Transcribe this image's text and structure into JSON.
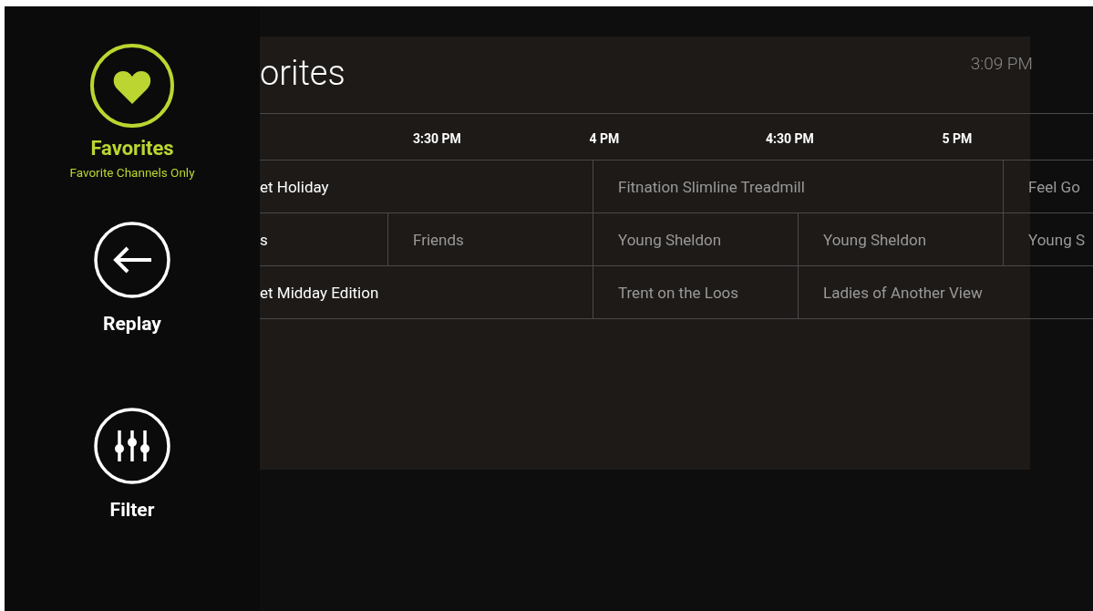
{
  "sidebar": {
    "items": [
      {
        "kind": "heart",
        "label": "Favorites",
        "subtitle": "Favorite Channels Only",
        "selected": true
      },
      {
        "kind": "back",
        "label": "Replay",
        "selected": false
      },
      {
        "kind": "filter",
        "label": "Filter",
        "selected": false
      }
    ]
  },
  "guide": {
    "title": "orites",
    "clock": "3:09 PM",
    "times": [
      "3:30 PM",
      "4 PM",
      "4:30 PM",
      "5 PM"
    ],
    "rows": [
      {
        "programs": [
          {
            "title": "et Holiday",
            "kind": "leadhalf",
            "airing": true
          },
          {
            "title": "Fitnation Slimline Treadmill",
            "kind": "hour",
            "airing": false
          },
          {
            "title": "Feel Go",
            "kind": "open",
            "airing": false
          }
        ]
      },
      {
        "programs": [
          {
            "title": "s",
            "kind": "lead",
            "airing": true
          },
          {
            "title": "Friends",
            "kind": "half",
            "airing": false
          },
          {
            "title": "Young Sheldon",
            "kind": "half",
            "airing": false
          },
          {
            "title": "Young Sheldon",
            "kind": "half",
            "airing": false
          },
          {
            "title": "Young S",
            "kind": "open",
            "airing": false
          }
        ]
      },
      {
        "programs": [
          {
            "title": "et Midday Edition",
            "kind": "leadhalf",
            "airing": true
          },
          {
            "title": "Trent on the Loos",
            "kind": "half",
            "airing": false
          },
          {
            "title": "Ladies of Another View",
            "kind": "open",
            "airing": false
          }
        ]
      }
    ]
  }
}
